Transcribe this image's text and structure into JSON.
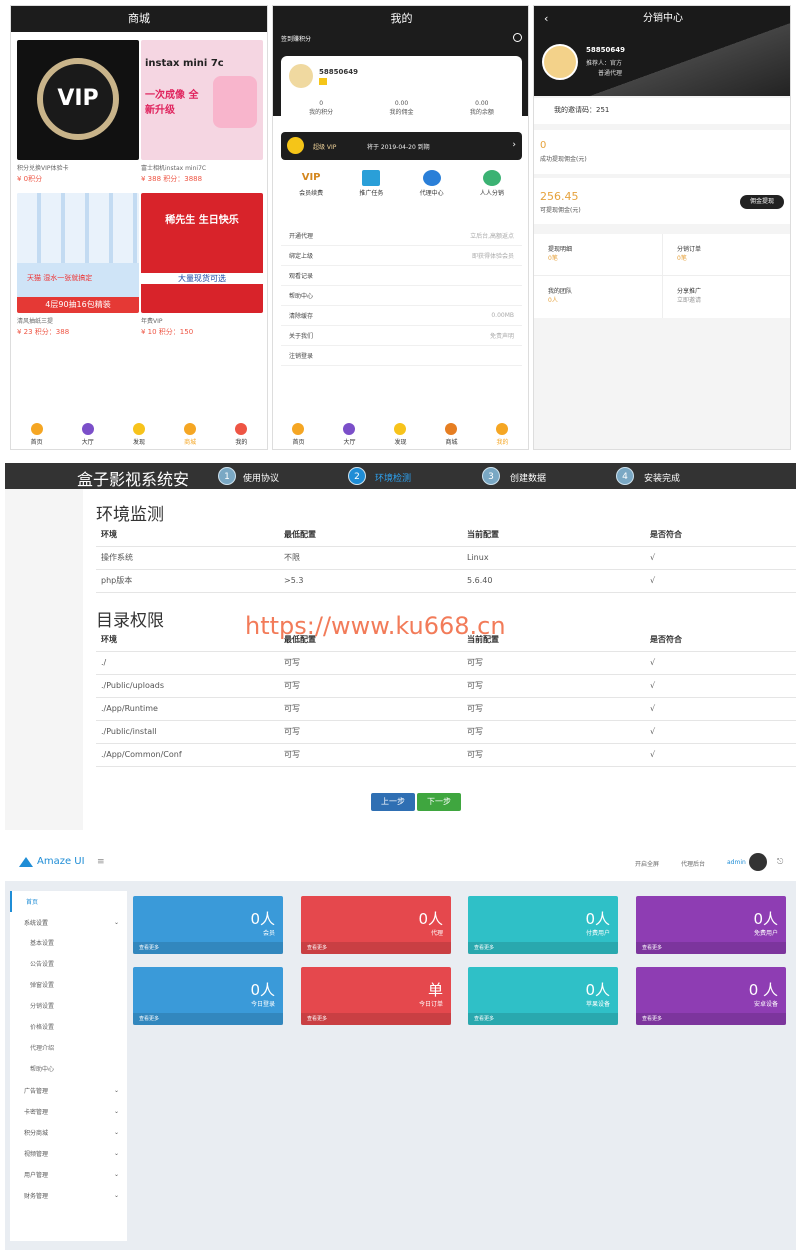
{
  "mall": {
    "title": "商城",
    "products": [
      {
        "name": "积分兑换VIP体验卡",
        "price": "¥ 0积分",
        "img_text": "VIP"
      },
      {
        "name": "富士相机instax mini7C",
        "price": "¥ 388 积分：3888",
        "img_text": "instax mini 7c",
        "img_sub": "一次成像 全新升级"
      },
      {
        "name": "清风抽纸三提",
        "price": "¥ 23 积分：388",
        "img_text": "4层90抽16包精装",
        "img_sub": "天猫 湿水一张就搞定"
      },
      {
        "name": "年费VIP",
        "price": "¥ 10 积分：150",
        "img_text": "稀先生 生日快乐",
        "img_sub": "大量现货可选"
      }
    ],
    "tabs": [
      "首页",
      "大厅",
      "发现",
      "商城",
      "我的"
    ]
  },
  "mine": {
    "title": "我的",
    "signin": "签到赚积分",
    "user": "58850649",
    "stats": [
      {
        "value": "0",
        "label": "我的积分"
      },
      {
        "value": "0.00",
        "label": "我的佣金"
      },
      {
        "value": "0.00",
        "label": "我的余额"
      }
    ],
    "vip_label": "超级 VIP",
    "vip_expire": "将于 2019-04-20 到期",
    "quick": [
      "会员续费",
      "推广任务",
      "代理中心",
      "人人分销"
    ],
    "quick_top": "VIP",
    "menu": [
      {
        "label": "开通代理",
        "right": "立后台,高额返点"
      },
      {
        "label": "绑定上级",
        "right": "即获得体验会员"
      },
      {
        "label": "观看记录",
        "right": ""
      },
      {
        "label": "帮助中心",
        "right": ""
      },
      {
        "label": "清除缓存",
        "right": "0.00MB"
      },
      {
        "label": "关于我们",
        "right": "免责声明"
      },
      {
        "label": "注销登录",
        "right": ""
      }
    ],
    "tabs": [
      "首页",
      "大厅",
      "发现",
      "商城",
      "我的"
    ]
  },
  "dist": {
    "title": "分销中心",
    "user": "58850649",
    "referrer": "推荐人：官方",
    "level": "普通代理",
    "invite": "我的邀请码：251",
    "success_val": "0",
    "success_lbl": "成功提现佣金(元)",
    "avail_val": "256.45",
    "avail_lbl": "可提现佣金(元)",
    "withdraw_btn": "佣金提现",
    "grid": [
      {
        "title": "提现明细",
        "sub": "0笔"
      },
      {
        "title": "分销订单",
        "sub": "0笔"
      },
      {
        "title": "我的团队",
        "sub": "0人"
      },
      {
        "title": "分享推广",
        "sub": "立即邀请"
      }
    ]
  },
  "install": {
    "brand": "盒子影视系统安",
    "steps": [
      {
        "num": "1",
        "label": "使用协议"
      },
      {
        "num": "2",
        "label": "环境检测"
      },
      {
        "num": "3",
        "label": "创建数据"
      },
      {
        "num": "4",
        "label": "安装完成"
      }
    ],
    "env_title": "环境监测",
    "env_headers": [
      "环境",
      "最低配置",
      "当前配置",
      "是否符合"
    ],
    "env_rows": [
      [
        "操作系统",
        "不限",
        "Linux",
        "√"
      ],
      [
        "php版本",
        ">5.3",
        "5.6.40",
        "√"
      ]
    ],
    "dir_title": "目录权限",
    "dir_headers": [
      "环境",
      "最低配置",
      "当前配置",
      "是否符合"
    ],
    "dir_rows": [
      [
        "./",
        "可写",
        "可写",
        "√"
      ],
      [
        "./Public/uploads",
        "可写",
        "可写",
        "√"
      ],
      [
        "./App/Runtime",
        "可写",
        "可写",
        "√"
      ],
      [
        "./Public/install",
        "可写",
        "可写",
        "√"
      ],
      [
        "./App/Common/Conf",
        "可写",
        "可写",
        "√"
      ]
    ],
    "prev_btn": "上一步",
    "next_btn": "下一步"
  },
  "watermark": "https://www.ku668.cn",
  "admin": {
    "logo": "Amaze UI",
    "fullscreen": "开启全屏",
    "agent_backend": "代理后台",
    "user": "admin",
    "sidebar": [
      {
        "label": "首页",
        "active": true,
        "expand": false
      },
      {
        "label": "系统设置",
        "active": false,
        "expand": true
      },
      {
        "label": "广告管理",
        "active": false,
        "expand": true
      },
      {
        "label": "卡密管理",
        "active": false,
        "expand": true
      },
      {
        "label": "积分商城",
        "active": false,
        "expand": true
      },
      {
        "label": "视频管理",
        "active": false,
        "expand": true
      },
      {
        "label": "用户管理",
        "active": false,
        "expand": true
      },
      {
        "label": "财务管理",
        "active": false,
        "expand": true
      }
    ],
    "sub_items": [
      "基本设置",
      "公告设置",
      "弹窗设置",
      "分销设置",
      "价格设置",
      "代理介绍",
      "帮助中心"
    ],
    "cards": [
      {
        "value": "0人",
        "label": "会员",
        "color": "#3a9ad9"
      },
      {
        "value": "0人",
        "label": "代理",
        "color": "#e5484d"
      },
      {
        "value": "0人",
        "label": "付费用户",
        "color": "#2fc0c7"
      },
      {
        "value": "0人",
        "label": "免费用户",
        "color": "#8e3db3"
      },
      {
        "value": "0人",
        "label": "今日登录",
        "color": "#3a9ad9"
      },
      {
        "value": "单",
        "label": "今日订单",
        "color": "#e5484d"
      },
      {
        "value": "0人",
        "label": "苹果设备",
        "color": "#2fc0c7"
      },
      {
        "value": "0 人",
        "label": "安卓设备",
        "color": "#8e3db3"
      }
    ],
    "more": "查看更多"
  }
}
